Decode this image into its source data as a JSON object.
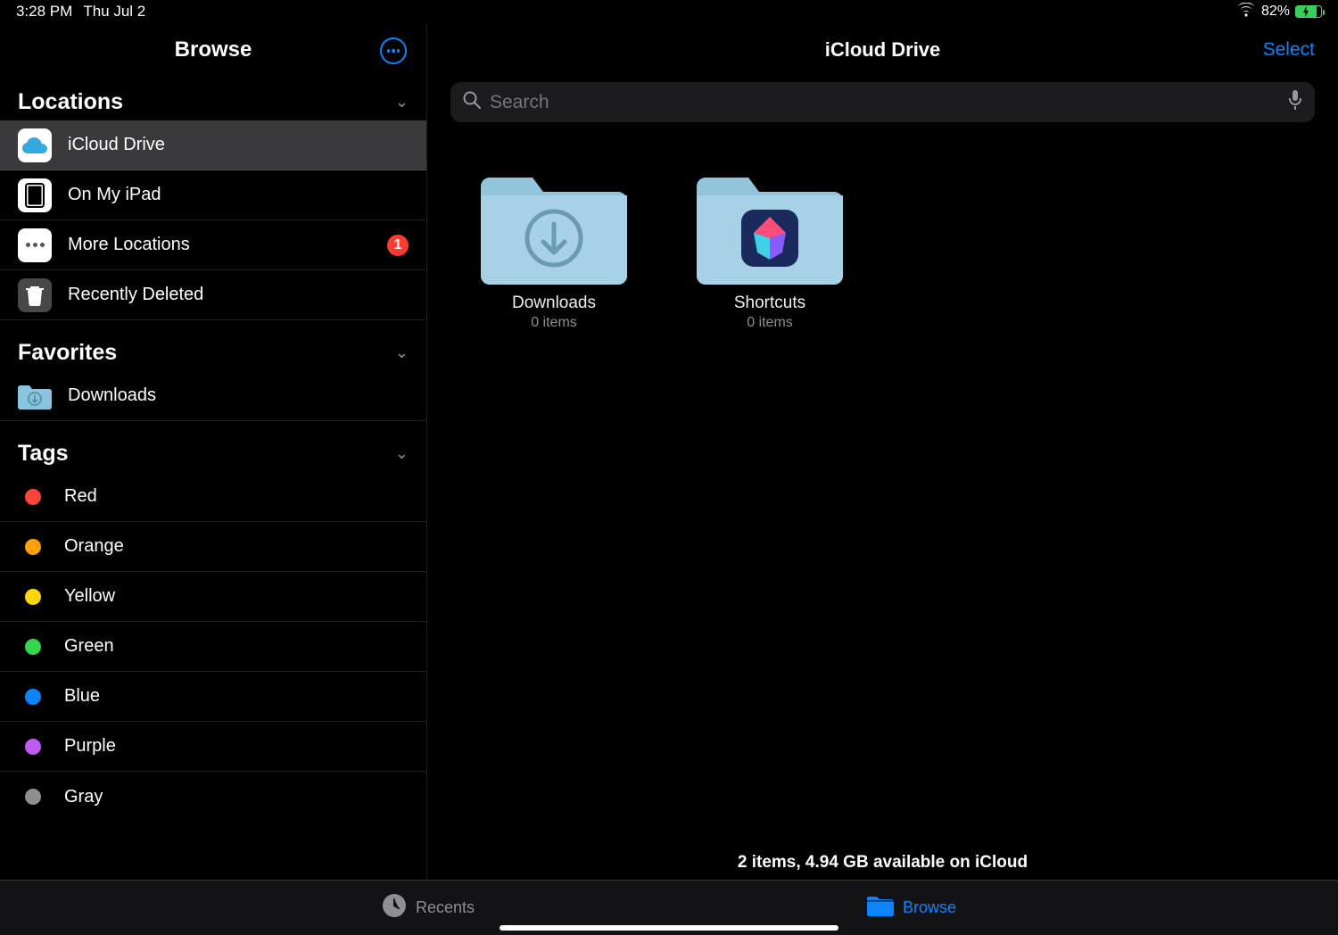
{
  "status": {
    "time": "3:28 PM",
    "date": "Thu Jul 2",
    "battery": "82%"
  },
  "sidebar": {
    "title": "Browse",
    "sections": {
      "locations": {
        "title": "Locations",
        "items": [
          {
            "label": "iCloud Drive",
            "selected": true,
            "icon": "icloud"
          },
          {
            "label": "On My iPad",
            "icon": "ipad"
          },
          {
            "label": "More Locations",
            "icon": "more",
            "badge": "1"
          },
          {
            "label": "Recently Deleted",
            "icon": "trash"
          }
        ]
      },
      "favorites": {
        "title": "Favorites",
        "items": [
          {
            "label": "Downloads",
            "icon": "downloads-folder"
          }
        ]
      },
      "tags": {
        "title": "Tags",
        "items": [
          {
            "label": "Red",
            "color": "#ff453a"
          },
          {
            "label": "Orange",
            "color": "#ff9f0a"
          },
          {
            "label": "Yellow",
            "color": "#ffd60a"
          },
          {
            "label": "Green",
            "color": "#32d74b"
          },
          {
            "label": "Blue",
            "color": "#0a84ff"
          },
          {
            "label": "Purple",
            "color": "#bf5af2"
          },
          {
            "label": "Gray",
            "color": "#8e8e93"
          }
        ]
      }
    }
  },
  "main": {
    "title": "iCloud Drive",
    "select_label": "Select",
    "search": {
      "placeholder": "Search"
    },
    "folders": [
      {
        "name": "Downloads",
        "sub": "0 items",
        "type": "downloads"
      },
      {
        "name": "Shortcuts",
        "sub": "0 items",
        "type": "shortcuts"
      }
    ],
    "status": "2 items, 4.94 GB available on iCloud"
  },
  "tabbar": {
    "recents": "Recents",
    "browse": "Browse"
  }
}
